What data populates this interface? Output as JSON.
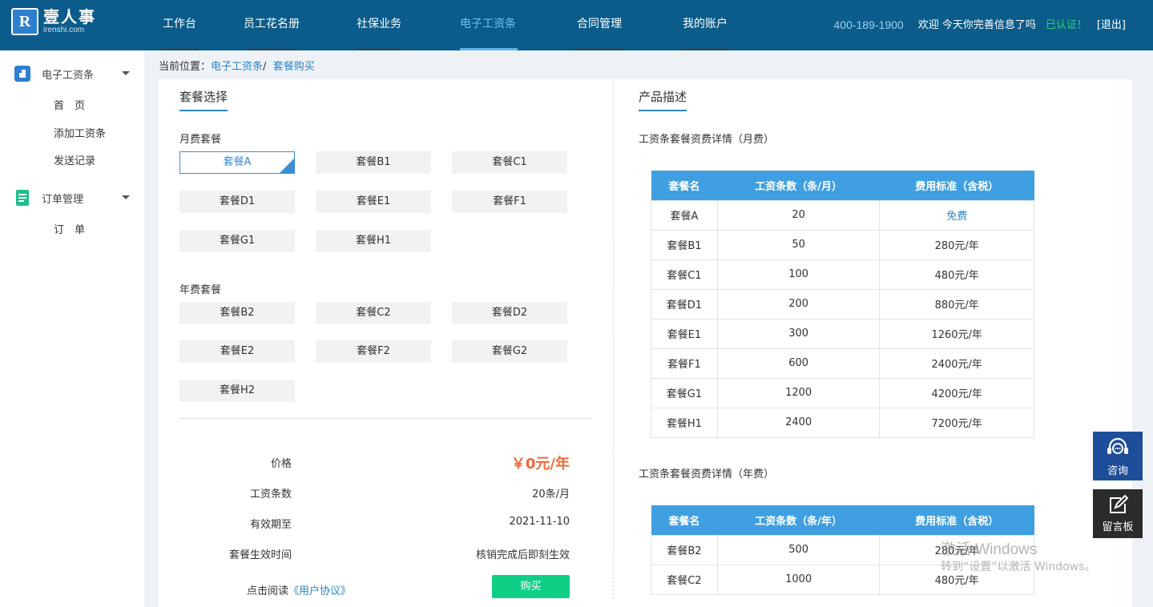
{
  "header": {
    "logo_cn": "壹人事",
    "logo_en": "irenshi.com",
    "logo_mark": "R",
    "nav": [
      "工作台",
      "员工花名册",
      "社保业务",
      "电子工资条",
      "合同管理",
      "我的账户"
    ],
    "active_nav": "电子工资条",
    "phone": "400-189-1900",
    "welcome": "欢迎  今天你完善信息了吗",
    "verified": "已认证！",
    "logout": "[退出]"
  },
  "sidebar": {
    "groups": [
      {
        "label": "电子工资条",
        "icon": "payslip-icon",
        "items": [
          "首　页",
          "添加工资条",
          "发送记录"
        ]
      },
      {
        "label": "订单管理",
        "icon": "order-icon",
        "items": [
          "订　单"
        ]
      }
    ]
  },
  "breadcrumb": {
    "prefix": "当前位置：",
    "level1": "电子工资条",
    "separator": "/",
    "level2": "套餐购买"
  },
  "selection": {
    "title": "套餐选择",
    "monthly_label": "月费套餐",
    "monthly": [
      "套餐A",
      "套餐B1",
      "套餐C1",
      "套餐D1",
      "套餐E1",
      "套餐F1",
      "套餐G1",
      "套餐H1"
    ],
    "selected": "套餐A",
    "yearly_label": "年费套餐",
    "yearly": [
      "套餐B2",
      "套餐C2",
      "套餐D2",
      "套餐E2",
      "套餐F2",
      "套餐G2",
      "套餐H2"
    ]
  },
  "summary": {
    "price_label": "价格",
    "price_value": "￥0元/年",
    "count_label": "工资条数",
    "count_value": "20条/月",
    "expire_label": "有效期至",
    "expire_value": "2021-11-10",
    "effect_label": "套餐生效时间",
    "effect_value": "核销完成后即刻生效",
    "agree_prefix": "点击阅读",
    "agree_link": "《用户协议》",
    "buy_label": "购买"
  },
  "description": {
    "title": "产品描述",
    "monthly_caption": "工资条套餐资费详情（月费）",
    "monthly_headers": [
      "套餐名",
      "工资条数（条/月）",
      "费用标准（含税）"
    ],
    "monthly_rows": [
      [
        "套餐A",
        "20",
        "免费"
      ],
      [
        "套餐B1",
        "50",
        "280元/年"
      ],
      [
        "套餐C1",
        "100",
        "480元/年"
      ],
      [
        "套餐D1",
        "200",
        "880元/年"
      ],
      [
        "套餐E1",
        "300",
        "1260元/年"
      ],
      [
        "套餐F1",
        "600",
        "2400元/年"
      ],
      [
        "套餐G1",
        "1200",
        "4200元/年"
      ],
      [
        "套餐H1",
        "2400",
        "7200元/年"
      ]
    ],
    "yearly_caption": "工资条套餐资费详情（年费）",
    "yearly_headers": [
      "套餐名",
      "工资条数（条/年）",
      "费用标准（含税）"
    ],
    "yearly_rows": [
      [
        "套餐B2",
        "500",
        "280元/年"
      ],
      [
        "套餐C2",
        "1000",
        "480元/年"
      ]
    ]
  },
  "float": {
    "consult": "咨询",
    "message": "留言板"
  },
  "watermark": {
    "line1": "激活 Windows",
    "line2": "转到“设置”以激活 Windows。"
  },
  "colors": {
    "header": "#0b5c8a",
    "accent": "#3f9fe0",
    "buy": "#0fcf86",
    "price": "#f06a3a"
  }
}
